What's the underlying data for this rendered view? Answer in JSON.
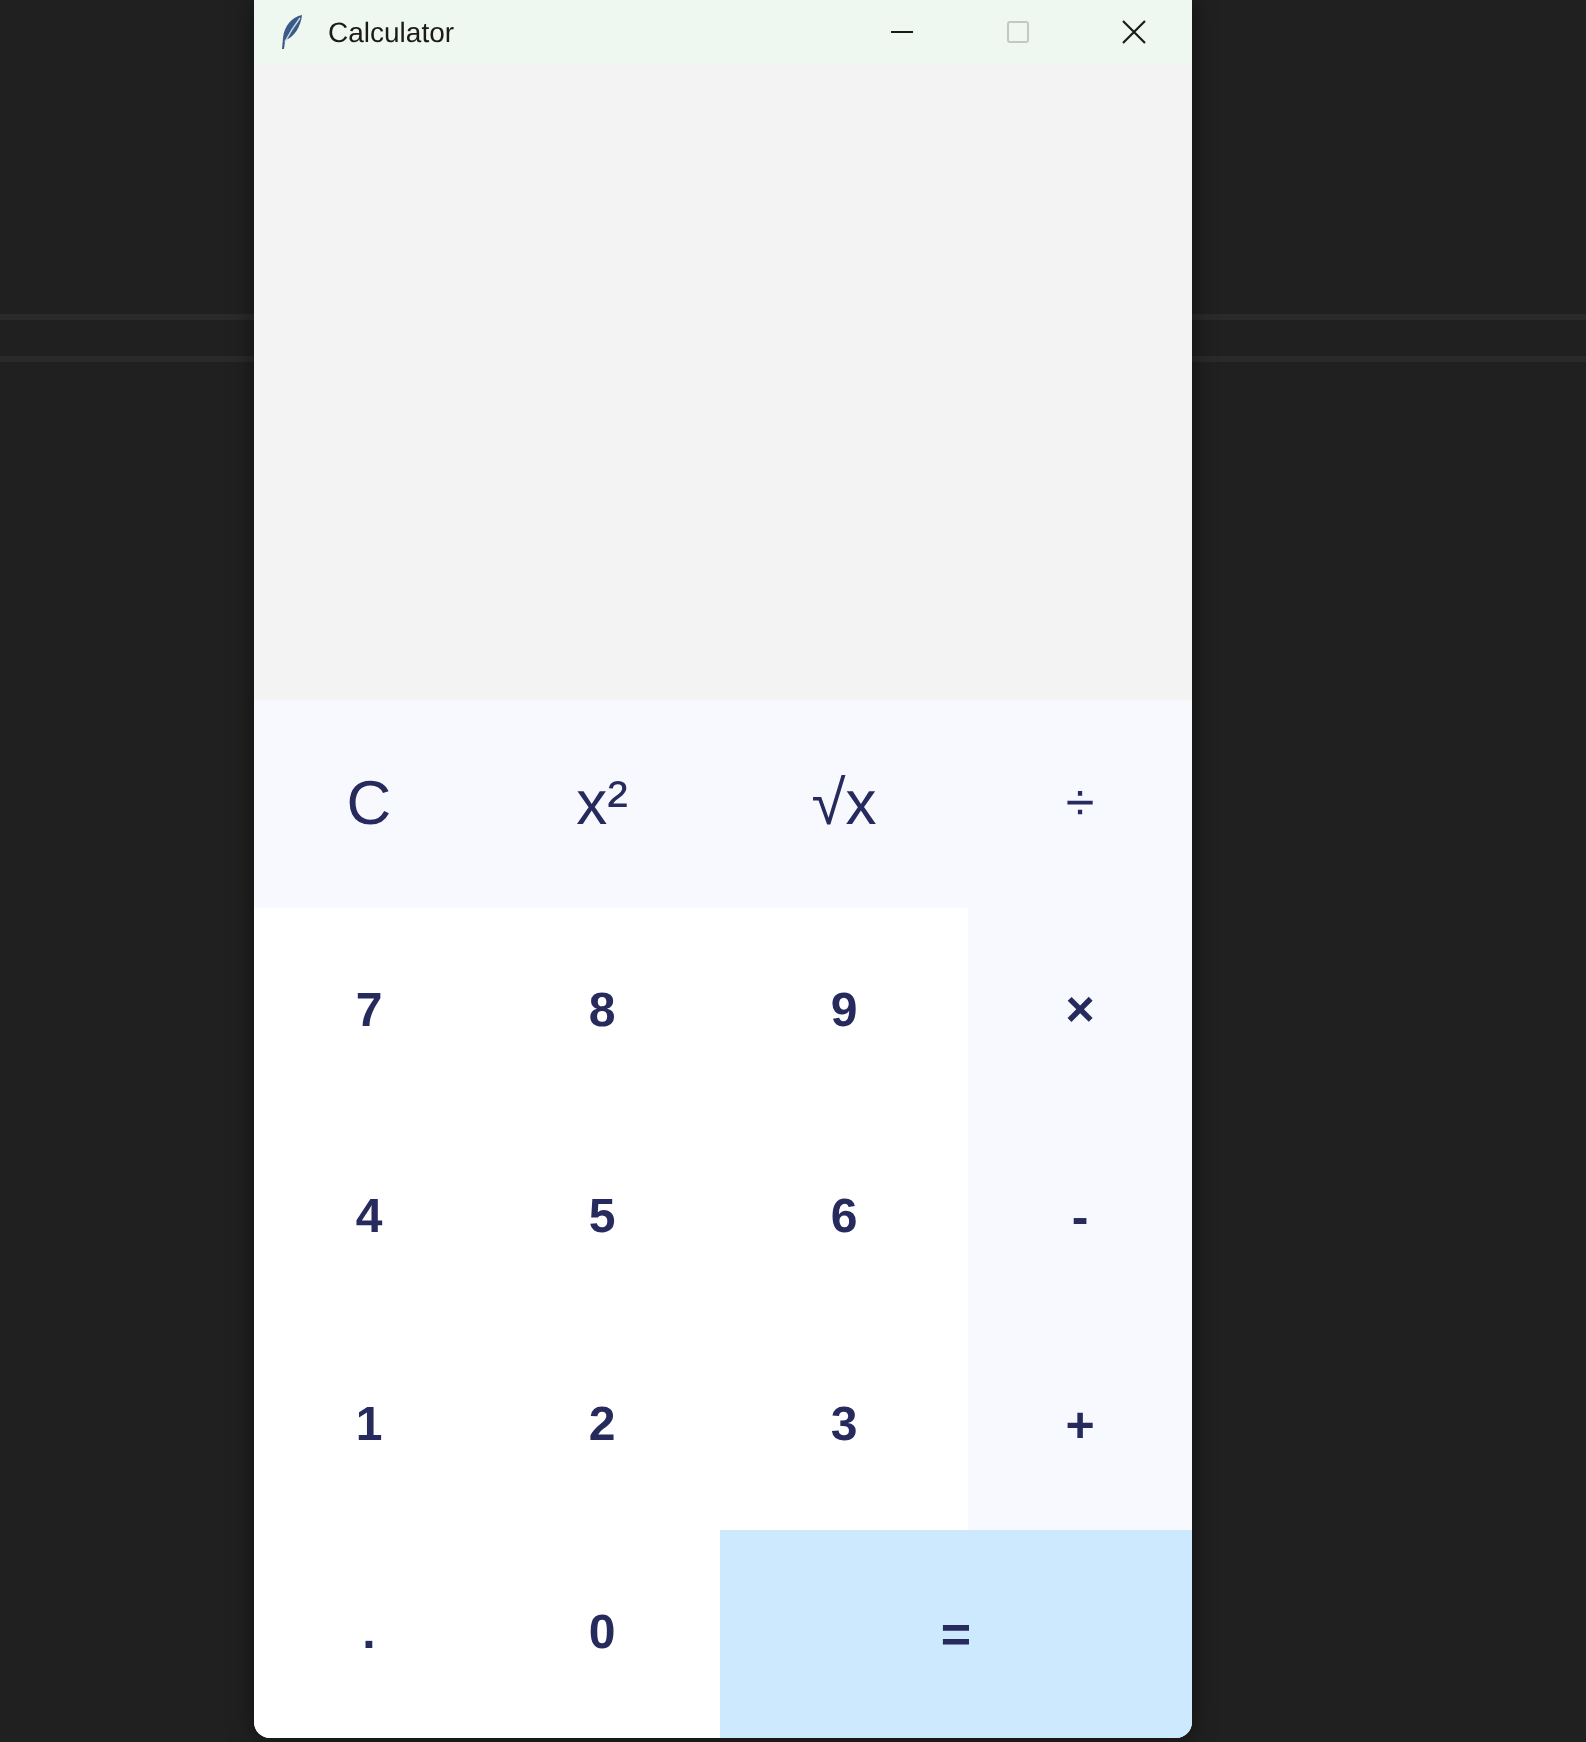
{
  "window": {
    "title": "Calculator",
    "maximize_disabled": true
  },
  "keys": [
    {
      "label": "C",
      "kind": "function"
    },
    {
      "label": "x²",
      "kind": "function"
    },
    {
      "label": "√x",
      "kind": "function"
    },
    {
      "label": "÷",
      "kind": "operator-light"
    },
    {
      "label": "7",
      "kind": "digit"
    },
    {
      "label": "8",
      "kind": "digit"
    },
    {
      "label": "9",
      "kind": "digit"
    },
    {
      "label": "×",
      "kind": "operator"
    },
    {
      "label": "4",
      "kind": "digit"
    },
    {
      "label": "5",
      "kind": "digit"
    },
    {
      "label": "6",
      "kind": "digit"
    },
    {
      "label": "-",
      "kind": "operator"
    },
    {
      "label": "1",
      "kind": "digit"
    },
    {
      "label": "2",
      "kind": "digit"
    },
    {
      "label": "3",
      "kind": "digit"
    },
    {
      "label": "+",
      "kind": "operator"
    },
    {
      "label": ".",
      "kind": "digit"
    },
    {
      "label": "0",
      "kind": "digit"
    },
    {
      "label": "=",
      "kind": "equals"
    }
  ]
}
